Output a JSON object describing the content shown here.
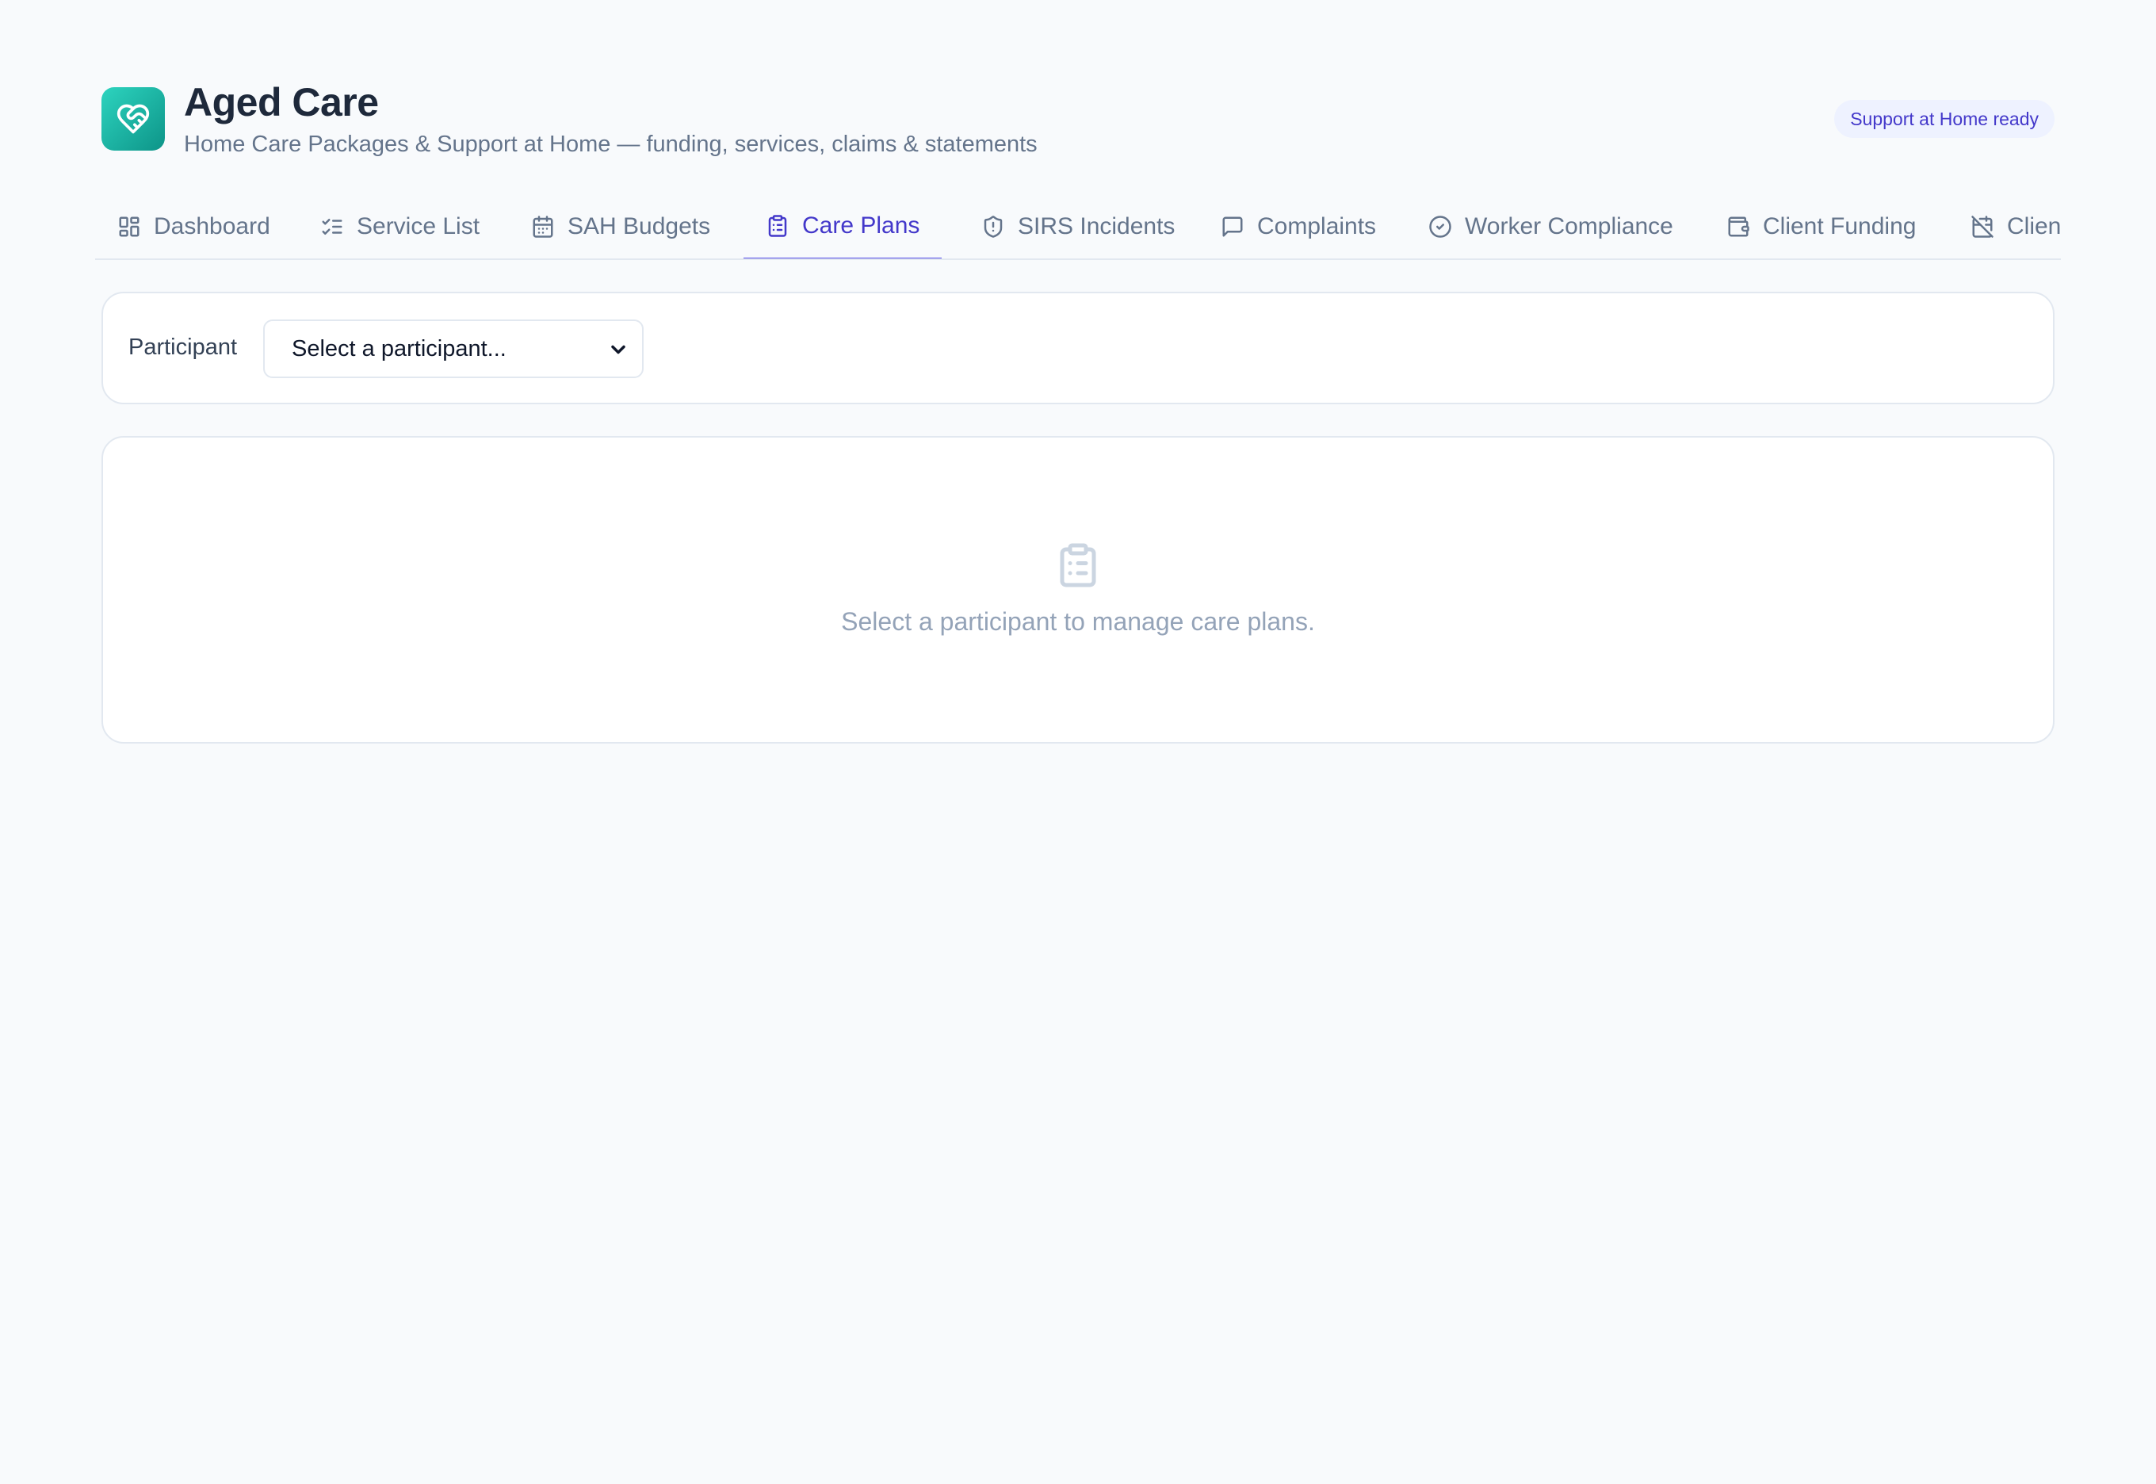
{
  "app": {
    "title": "Aged Care",
    "subtitle": "Home Care Packages & Support at Home — funding, services, claims & statements",
    "logo_icon": "heart-handshake-icon",
    "badge": "Support at Home ready",
    "accent_color": "#4f46e5",
    "logo_color": "#14b8a6"
  },
  "tabs": [
    {
      "label": "Dashboard",
      "icon": "layout-grid-icon",
      "active": false
    },
    {
      "label": "Service List",
      "icon": "list-checks-icon",
      "active": false
    },
    {
      "label": "SAH Budgets",
      "icon": "calendar-icon",
      "active": false
    },
    {
      "label": "Care Plans",
      "icon": "clipboard-list-icon",
      "active": true
    },
    {
      "label": "SIRS Incidents",
      "icon": "shield-alert-icon",
      "active": false
    },
    {
      "label": "Complaints",
      "icon": "message-square-icon",
      "active": false
    },
    {
      "label": "Worker Compliance",
      "icon": "check-circle-icon",
      "active": false
    },
    {
      "label": "Client Funding",
      "icon": "wallet-icon",
      "active": false
    },
    {
      "label": "Client L",
      "icon": "calendar-off-icon",
      "active": false
    }
  ],
  "filter": {
    "label": "Participant",
    "select_value": "Select a participant..."
  },
  "empty_state": {
    "icon": "clipboard-list-icon",
    "message": "Select a participant to manage care plans."
  }
}
